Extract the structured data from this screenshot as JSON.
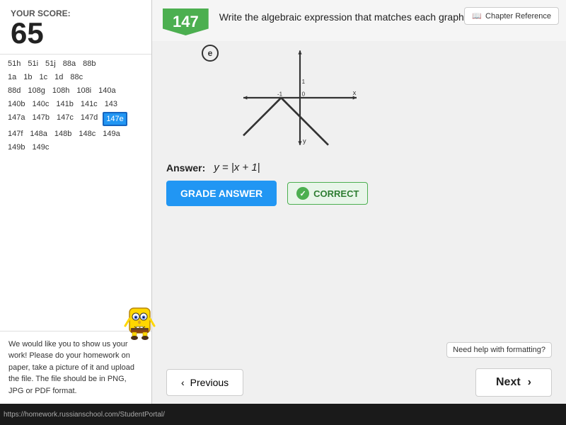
{
  "score": {
    "label": "YOUR SCORE:",
    "value": "65"
  },
  "problem": {
    "number": "147",
    "letter": "e",
    "instruction": "Write the algebraic expression that matches each graph:",
    "answer_label": "Answer:",
    "answer_expression": "y = |x + 1|"
  },
  "buttons": {
    "grade_answer": "GRADE ANSWER",
    "correct": "CORRECT",
    "previous": "Previous",
    "next": "Next",
    "chapter_reference": "Chapter Reference",
    "help_formatting": "Need help with formatting?"
  },
  "nav_items": [
    {
      "label": "51h",
      "active": false
    },
    {
      "label": "51i",
      "active": false
    },
    {
      "label": "51j",
      "active": false
    },
    {
      "label": "88a",
      "active": false
    },
    {
      "label": "88b",
      "active": false
    },
    {
      "label": "1a",
      "active": false
    },
    {
      "label": "1b",
      "active": false
    },
    {
      "label": "1c",
      "active": false
    },
    {
      "label": "1d",
      "active": false
    },
    {
      "label": "88c",
      "active": false
    },
    {
      "label": "88d",
      "active": false
    },
    {
      "label": "108g",
      "active": false
    },
    {
      "label": "108h",
      "active": false
    },
    {
      "label": "108i",
      "active": false
    },
    {
      "label": "140a",
      "active": false
    },
    {
      "label": "140b",
      "active": false
    },
    {
      "label": "140c",
      "active": false
    },
    {
      "label": "141b",
      "active": false
    },
    {
      "label": "141c",
      "active": false
    },
    {
      "label": "143",
      "active": false
    },
    {
      "label": "147a",
      "active": false
    },
    {
      "label": "147b",
      "active": false
    },
    {
      "label": "147c",
      "active": false
    },
    {
      "label": "147d",
      "active": false
    },
    {
      "label": "147e",
      "active": true
    },
    {
      "label": "147f",
      "active": false
    },
    {
      "label": "148a",
      "active": false
    },
    {
      "label": "148b",
      "active": false
    },
    {
      "label": "148c",
      "active": false
    },
    {
      "label": "149a",
      "active": false
    },
    {
      "label": "149b",
      "active": false
    },
    {
      "label": "149c",
      "active": false
    }
  ],
  "homework_text": "We would like you to show us your work! Please do your homework on paper, take a picture of it and upload the file. The file should be in PNG, JPG or PDF format.",
  "url": "https://homework.russianschool.com/StudentPortal/",
  "colors": {
    "grade_btn": "#2196F3",
    "correct_green": "#4CAF50",
    "problem_number_bg": "#4CAF50",
    "active_nav": "#2196F3"
  }
}
